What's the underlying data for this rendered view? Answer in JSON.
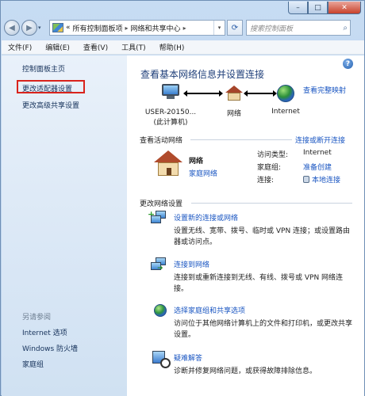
{
  "window": {
    "min_glyph": "–",
    "max_glyph": "□",
    "close_glyph": "✕"
  },
  "address_bar": {
    "back_glyph": "◀",
    "forward_glyph": "▶",
    "dropdown_glyph": "▾",
    "prefix": "«",
    "crumbs": [
      "所有控制面板项",
      "网络和共享中心"
    ],
    "separator": "▸",
    "refresh_glyph": "⟳",
    "search_placeholder": "搜索控制面板",
    "search_glyph": "⌕"
  },
  "menu": [
    "文件(F)",
    "编辑(E)",
    "查看(V)",
    "工具(T)",
    "帮助(H)"
  ],
  "sidebar": {
    "home": "控制面板主页",
    "adapter": "更改适配器设置",
    "advanced_sharing": "更改高级共享设置",
    "see_also": "另请参阅",
    "internet_options": "Internet 选项",
    "firewall": "Windows 防火墙",
    "homegroup": "家庭组"
  },
  "main": {
    "help_glyph": "?",
    "title": "查看基本网络信息并设置连接",
    "full_map": "查看完整映射",
    "map": {
      "computer": "USER-20150...",
      "computer_sub": "(此计算机)",
      "network": "网络",
      "internet": "Internet"
    },
    "active_networks_heading": "查看活动网络",
    "connect_disconnect": "连接或断开连接",
    "network_name": "网络",
    "network_type": "家庭网络",
    "info": [
      {
        "key": "访问类型:",
        "value": "Internet",
        "is_link": false
      },
      {
        "key": "家庭组:",
        "value": "准备创建",
        "is_link": true
      },
      {
        "key": "连接:",
        "value": "本地连接",
        "is_link": true
      }
    ],
    "change_settings_heading": "更改网络设置",
    "tasks": [
      {
        "title": "设置新的连接或网络",
        "desc": "设置无线、宽带、拨号、临时或 VPN 连接；或设置路由器或访问点。"
      },
      {
        "title": "连接到网络",
        "desc": "连接到或重新连接到无线、有线、拨号或 VPN 网络连接。"
      },
      {
        "title": "选择家庭组和共享选项",
        "desc": "访问位于其他网络计算机上的文件和打印机，或更改共享设置。"
      },
      {
        "title": "疑难解答",
        "desc": "诊断并修复网络问题，或获得故障排除信息。"
      }
    ]
  },
  "colors": {
    "link": "#1a56c2",
    "highlight_box": "#d9231c",
    "sidebar_bg": "#dce9f6",
    "title": "#1f3f7a"
  }
}
